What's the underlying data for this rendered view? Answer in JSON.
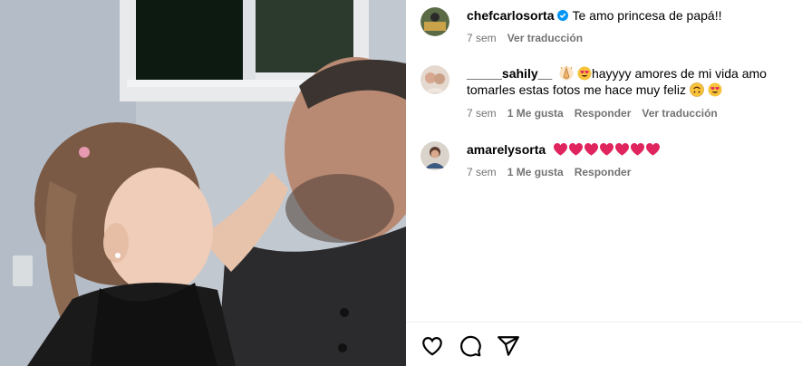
{
  "post": {
    "image_alt_icon": "photo-father-daughter"
  },
  "comments": [
    {
      "username": "chefcarlosorta",
      "verified": true,
      "text": "Te amo princesa de papá!!",
      "time": "7 sem",
      "translate": "Ver traducción"
    },
    {
      "username": "_____sahily__",
      "text_part1": "hayyyy amores de mi vida amo tomarles estas fotos me hace muy feliz",
      "time": "7 sem",
      "likes": "1 Me gusta",
      "reply": "Responder",
      "translate": "Ver traducción"
    },
    {
      "username": "amarelysorta",
      "hearts": 7,
      "time": "7 sem",
      "likes": "1 Me gusta",
      "reply": "Responder"
    }
  ],
  "actions": {
    "like_icon": "heart-icon",
    "comment_icon": "comment-icon",
    "share_icon": "share-icon"
  },
  "colors": {
    "meta_text": "#737373",
    "verified": "#0095f6",
    "heart_red": "#e0245e"
  }
}
